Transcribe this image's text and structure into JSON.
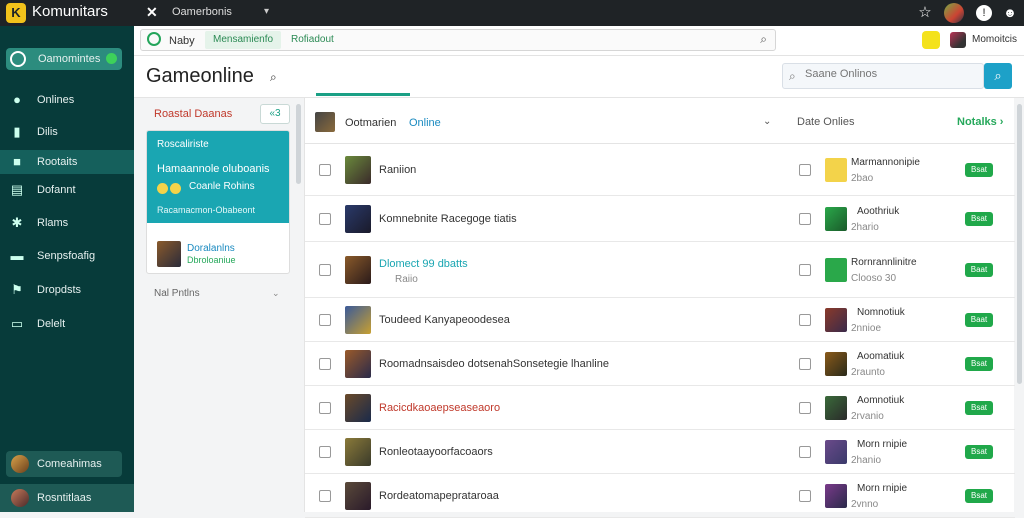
{
  "topbar": {
    "app_title": "Komunitars",
    "menu_label": "Oamerbonis",
    "menu_caret": "▾",
    "icons": [
      "x-icon",
      "star-icon",
      "avatar-icon",
      "info-icon",
      "user-icon"
    ]
  },
  "sidebar": {
    "header": "Oamomintes",
    "items": [
      {
        "label": "Onlines",
        "icon": "chat-icon"
      },
      {
        "label": "Dilis",
        "icon": "doc-icon"
      },
      {
        "label": "Rootaits",
        "icon": "team-icon",
        "active": true
      },
      {
        "label": "Dofannt",
        "icon": "chart-icon"
      },
      {
        "label": "Rlams",
        "icon": "gear-icon"
      },
      {
        "label": "Senpsfoafig",
        "icon": "list-icon"
      },
      {
        "label": "Dropdsts",
        "icon": "flag-icon"
      },
      {
        "label": "Delelt",
        "icon": "tv-icon"
      }
    ],
    "footer_1": "Comeahimas",
    "footer_2": "Rosntitlaas"
  },
  "searchbar": {
    "lead": "Naby",
    "tab_1": "Mensamienfo",
    "tab_2": "Rofiadout",
    "user_name": "Momoitcis"
  },
  "titlebar": {
    "title": "Gameonline",
    "search_placeholder": "Saane Onlinos"
  },
  "filters": {
    "header": "Roastal Daanas",
    "toggle": "«3",
    "card_title": "Roscaliriste",
    "card_line": "Hamaannole oluboanis",
    "card_coins": "Coanle Rohins",
    "card_foot": "Racamacmon-Obabeont",
    "card_item_title": "Doralanlns",
    "card_item_sub": "Dbroloaniue",
    "select": "Nal Pntlns"
  },
  "main": {
    "header_name": "Ootmarien",
    "header_status": "Online",
    "header_date": "Date Onlies",
    "header_action": "Notalks",
    "rows": [
      {
        "name": "Raniion",
        "sub": "",
        "other": "Marmannonipie",
        "time": "2bao",
        "btn": "Bsat",
        "name_color": "#333"
      },
      {
        "name": "Komnebnite Racegoge tiatis",
        "sub": "",
        "other": "Aoothriuk",
        "time": "2hario",
        "btn": "Bsat",
        "name_color": "#333"
      },
      {
        "name": "Dlomect 99 dbatts",
        "sub": "Raiio",
        "other": "Rornrannlinitre",
        "time": "Clooso 30",
        "btn": "Baat",
        "name_color": "#1aa6b2"
      },
      {
        "name": "Toudeed Kanyapeoodesea",
        "sub": "",
        "other": "Nomnotiuk",
        "time": "2nnioe",
        "btn": "Baat",
        "name_color": "#333"
      },
      {
        "name": "Roomadnsaisdeo dotsenahSonsetegie lhanline",
        "sub": "",
        "other": "Aoomatiuk",
        "time": "2raunto",
        "btn": "Bsat",
        "name_color": "#333"
      },
      {
        "name": "Racicdkaoaepseaseaoro",
        "sub": "",
        "other": "Aomnotiuk",
        "time": "2rvanio",
        "btn": "Bsat",
        "name_color": "#c0392b"
      },
      {
        "name": "Ronleotaayoorfacoaors",
        "sub": "",
        "other": "Morn rnipie",
        "time": "2hanio",
        "btn": "Bsat",
        "name_color": "#333"
      },
      {
        "name": "Rordeatomapeprataroaa",
        "sub": "",
        "other": "Morn rnipie",
        "time": "2vnno",
        "btn": "Bsat",
        "name_color": "#333"
      }
    ]
  }
}
